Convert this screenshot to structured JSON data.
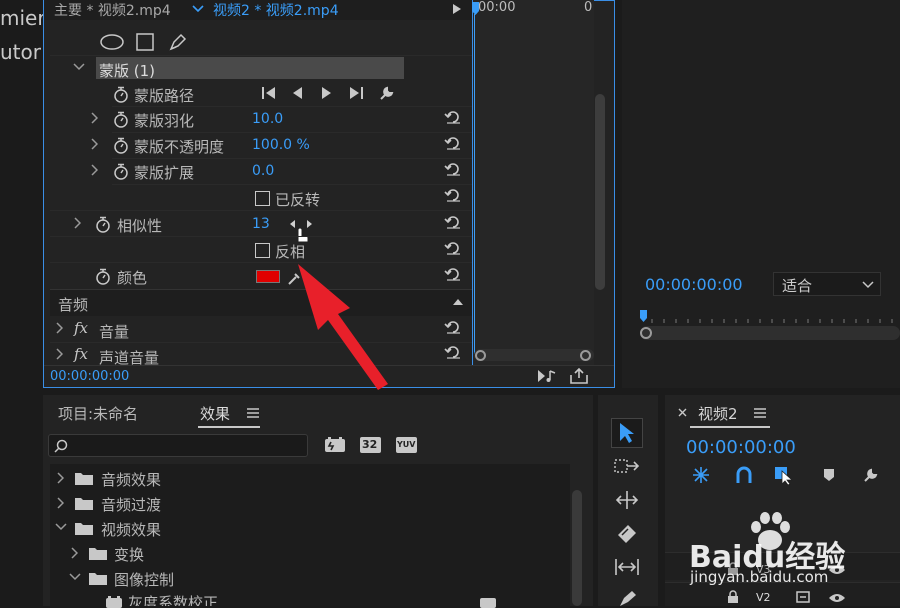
{
  "left_edge": {
    "line1": "mier",
    "line2": "utor"
  },
  "effect_controls": {
    "tab_main": "主要 * 视频2.mp4",
    "tab_active": "视频2 * 视频2.mp4",
    "mask_name": "蒙版 (1)",
    "mask_path_label": "蒙版路径",
    "feather_label": "蒙版羽化",
    "feather_value": "10.0",
    "opacity_label": "蒙版不透明度",
    "opacity_value": "100.0 %",
    "expand_label": "蒙版扩展",
    "expand_value": "0.0",
    "inverted_label": "已反转",
    "similarity_label": "相似性",
    "similarity_value": "13",
    "invert_label": "反相",
    "color_label": "颜色",
    "color_value": "#e00000",
    "audio_header": "音频",
    "volume_label": "音量",
    "channel_volume_label": "声道音量",
    "timecode": "00:00:00:00",
    "ruler_start": "00:00",
    "ruler_end": "0"
  },
  "program_monitor": {
    "timecode": "00:00:00:00",
    "fit_label": "适合"
  },
  "project_panel": {
    "tab_project": "项目:未命名",
    "tab_effects": "效果",
    "search_placeholder": "",
    "filter_32": "32",
    "filter_yuv": "YUV",
    "tree": [
      {
        "label": "音频效果"
      },
      {
        "label": "音频过渡"
      },
      {
        "label": "视频效果"
      },
      {
        "label": "变换"
      },
      {
        "label": "图像控制"
      },
      {
        "label": "灰度系数校正"
      }
    ]
  },
  "timeline": {
    "sequence_name": "视频2",
    "timecode": "00:00:00:00",
    "track_v3": "V3",
    "track_v2": "V2"
  },
  "watermark": {
    "brand": "Baidu经验",
    "url": "jingyan.baidu.com"
  }
}
